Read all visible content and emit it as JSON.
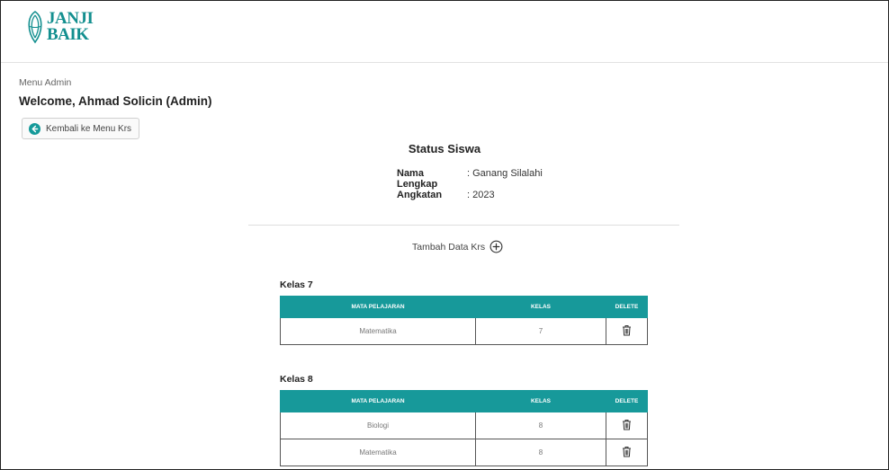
{
  "header": {
    "logo_line1": "JANJI",
    "logo_line2": "BAIK",
    "brand_color": "#138f8f"
  },
  "menu_label": "Menu Admin",
  "welcome": "Welcome, Ahmad Solicin (Admin)",
  "back_button": {
    "label": "Kembali ke Menu Krs",
    "icon": "arrow-left-circle-icon"
  },
  "status": {
    "title": "Status Siswa",
    "nama_label": "Nama Lengkap",
    "nama_value": ": Ganang Silalahi",
    "angkatan_label": "Angkatan",
    "angkatan_value": ": 2023"
  },
  "tambah": {
    "label": "Tambah Data Krs",
    "icon": "plus-circle-icon"
  },
  "table_headers": {
    "mapel": "MATA PELAJARAN",
    "kelas": "KELAS",
    "delete": "DELETE"
  },
  "accent_color": "#17999a",
  "kelas_groups": [
    {
      "title": "Kelas 7",
      "rows": [
        {
          "mapel": "Matematika",
          "kelas": "7"
        }
      ]
    },
    {
      "title": "Kelas 8",
      "rows": [
        {
          "mapel": "Biologi",
          "kelas": "8"
        },
        {
          "mapel": "Matematika",
          "kelas": "8"
        }
      ]
    }
  ]
}
